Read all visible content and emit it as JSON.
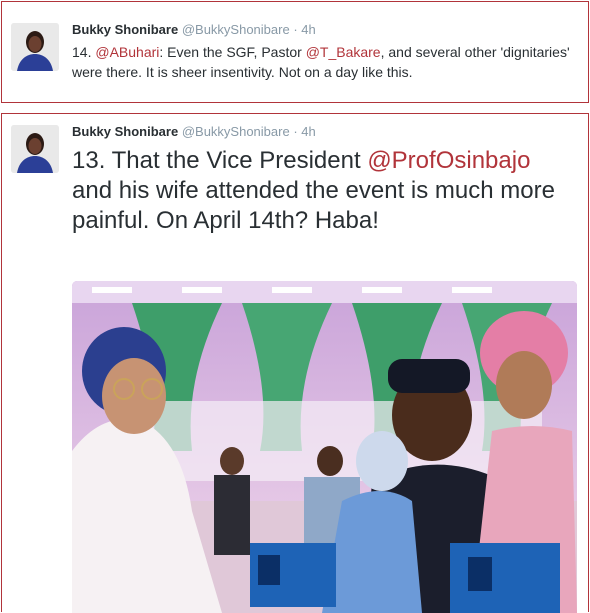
{
  "tweets": [
    {
      "name": "Bukky Shonibare",
      "handle": "@BukkyShonibare",
      "separator": "·",
      "time": "4h",
      "text": {
        "prefix": "14. ",
        "mention1": "@ABuhari",
        "mid1": ": Even the SGF, Pastor ",
        "mention2": "@T_Bakare",
        "rest": ", and several other 'dignitaries' were there. It is sheer insentivity. Not on a day like this."
      }
    },
    {
      "name": "Bukky Shonibare",
      "handle": "@BukkyShonibare",
      "separator": "·",
      "time": "4h",
      "text": {
        "prefix": "13. That the Vice President ",
        "mention1": "@ProfOsinbajo",
        "rest": " and his wife attended the event is much more painful. On April 14th? Haba!"
      }
    }
  ],
  "colors": {
    "accent": "#b1343a",
    "text": "#292f33",
    "muted": "#8899a6"
  }
}
